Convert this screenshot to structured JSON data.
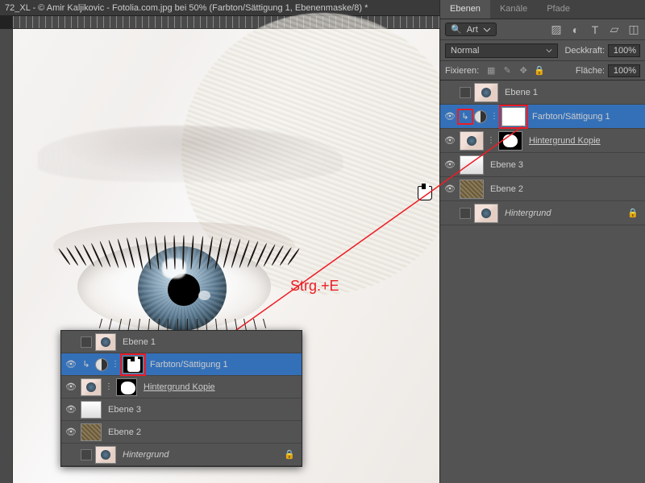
{
  "title": "72_XL - © Amir Kaljikovic - Fotolia.com.jpg bei 50% (Farbton/Sättigung 1, Ebenenmaske/8) *",
  "tabs": {
    "layers": "Ebenen",
    "channels": "Kanäle",
    "paths": "Pfade"
  },
  "kind": {
    "label": "Art"
  },
  "blend": {
    "mode": "Normal",
    "opacity_label": "Deckkraft:",
    "opacity": "100%"
  },
  "lock": {
    "label": "Fixieren:",
    "fill_label": "Fläche:",
    "fill": "100%"
  },
  "layers": [
    {
      "name": "Ebene 1"
    },
    {
      "name": "Farbton/Sättigung 1"
    },
    {
      "name": "Hintergrund Kopie"
    },
    {
      "name": "Ebene 3"
    },
    {
      "name": "Ebene 2"
    },
    {
      "name": "Hintergrund"
    }
  ],
  "annotation": "Strg.+E"
}
